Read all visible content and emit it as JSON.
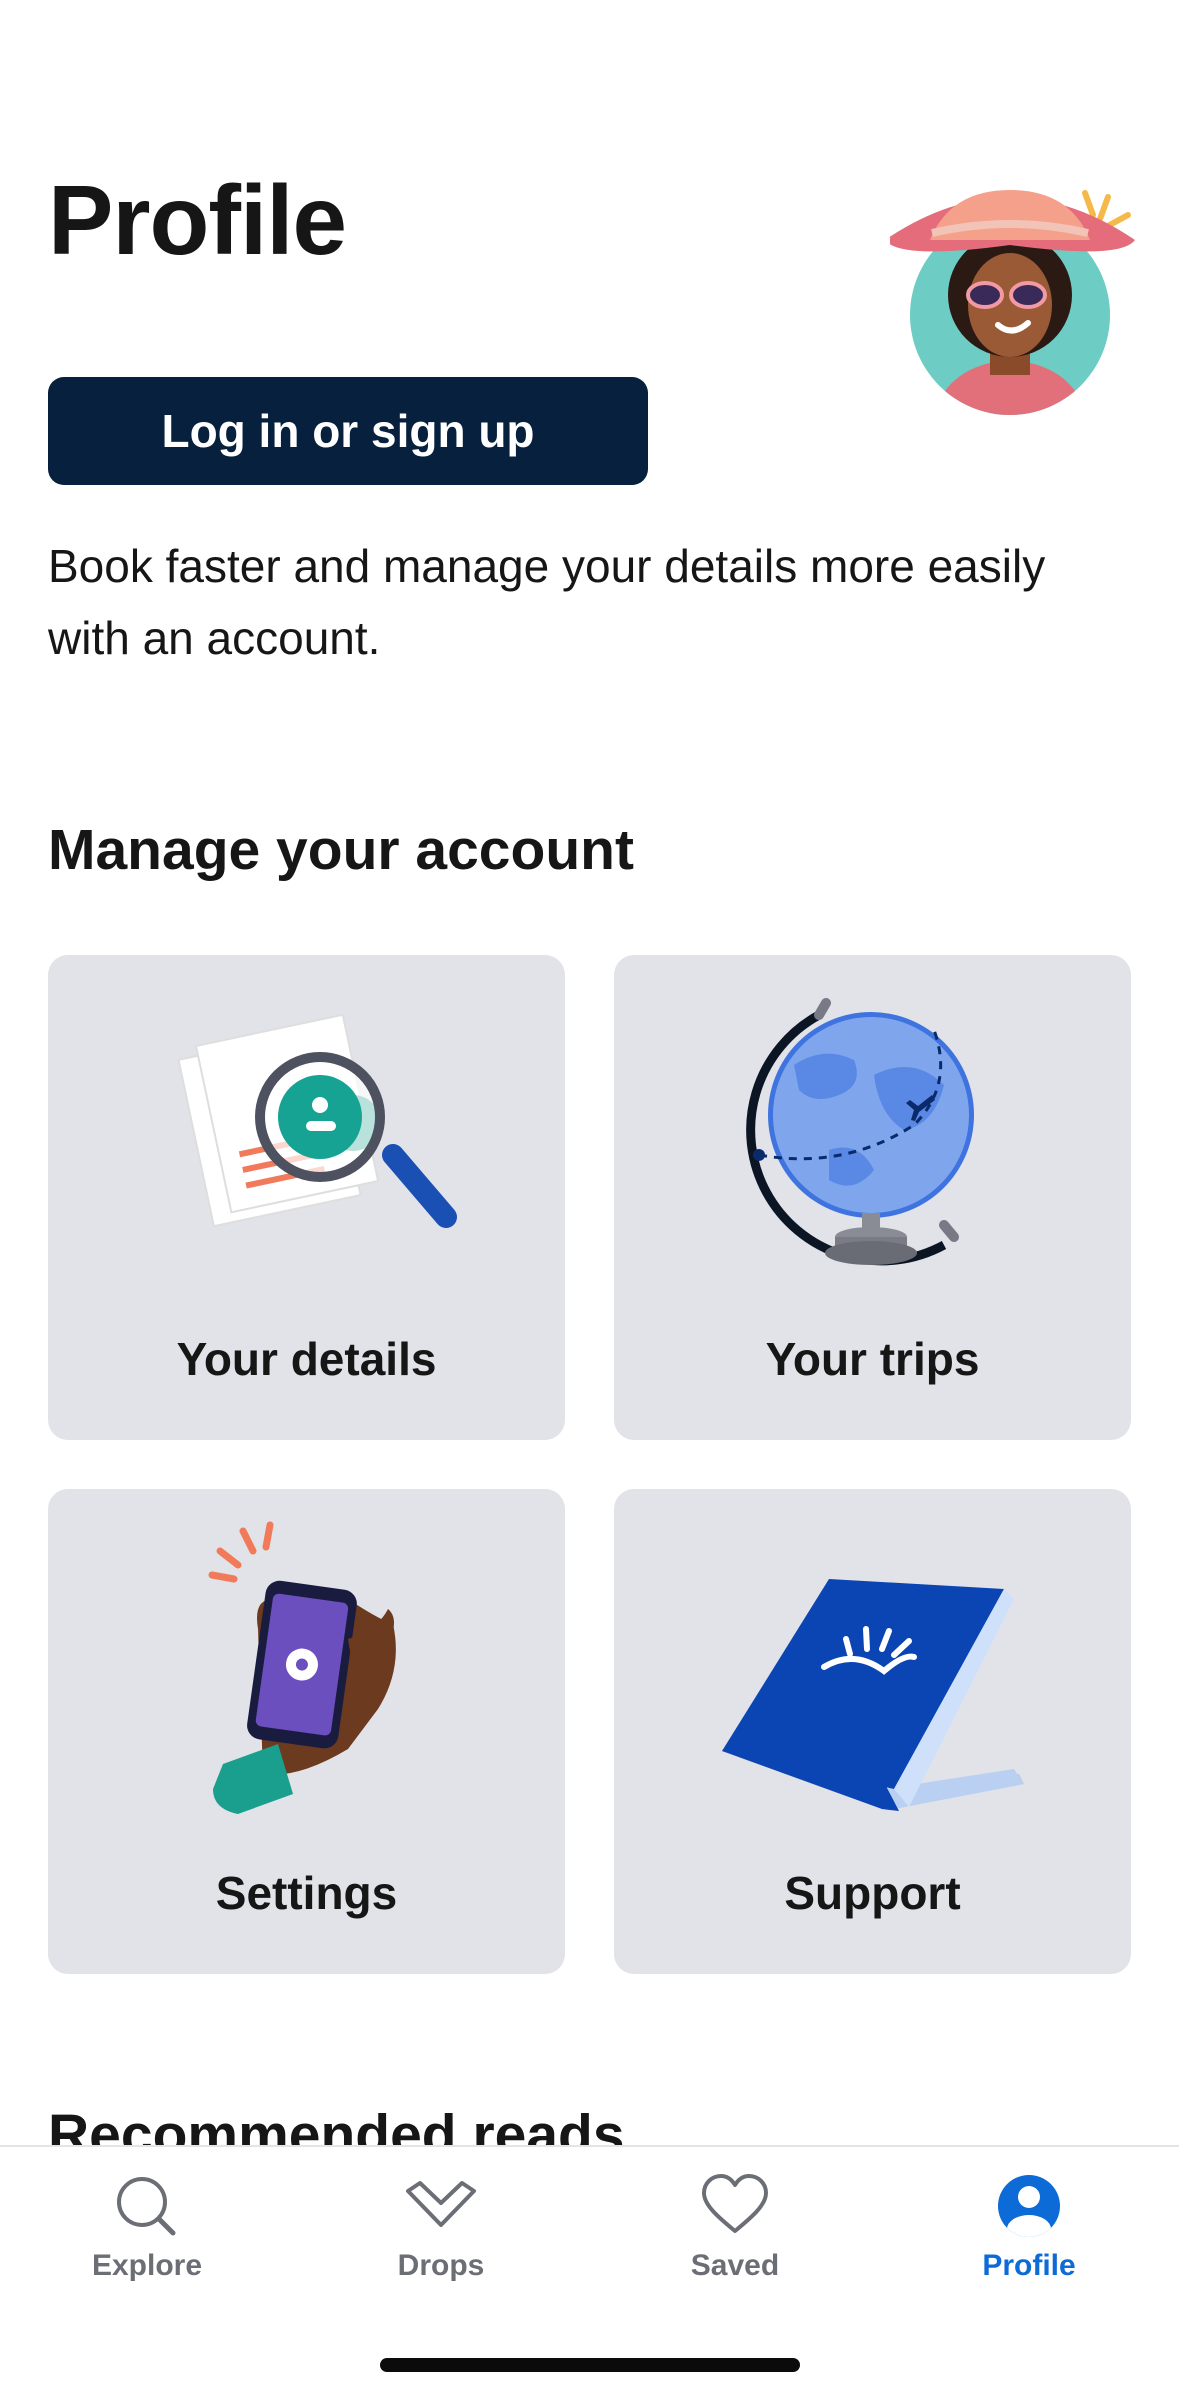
{
  "header": {
    "title": "Profile",
    "avatar_icon": "traveler-avatar-icon"
  },
  "auth": {
    "login_label": "Log in or sign up",
    "description": "Book faster and manage your details more easily with an account."
  },
  "manage": {
    "title": "Manage your account",
    "cards": [
      {
        "label": "Your details",
        "icon": "magnifier-document-icon"
      },
      {
        "label": "Your trips",
        "icon": "globe-icon"
      },
      {
        "label": "Settings",
        "icon": "phone-settings-icon"
      },
      {
        "label": "Support",
        "icon": "book-icon"
      }
    ]
  },
  "recommended": {
    "title": "Recommended reads"
  },
  "tabbar": {
    "tabs": [
      {
        "label": "Explore",
        "icon": "search-icon",
        "active": false
      },
      {
        "label": "Drops",
        "icon": "chevron-down-icon",
        "active": false
      },
      {
        "label": "Saved",
        "icon": "heart-icon",
        "active": false
      },
      {
        "label": "Profile",
        "icon": "profile-icon",
        "active": true
      }
    ]
  },
  "colors": {
    "primary_button": "#06203d",
    "active_tab": "#0c6bd6",
    "inactive_tab": "#6b6e75",
    "card_background": "#e1e3e8"
  }
}
